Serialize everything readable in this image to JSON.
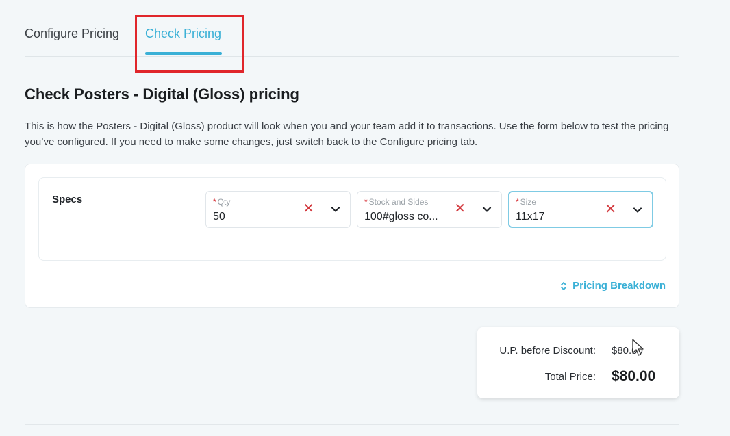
{
  "tabs": [
    {
      "label": "Configure Pricing",
      "active": false
    },
    {
      "label": "Check Pricing",
      "active": true
    }
  ],
  "heading": "Check Posters - Digital (Gloss) pricing",
  "description": "This is how the Posters - Digital (Gloss) product will look when you and your team add it to transactions. Use the form below to test the pricing you’ve configured. If you need to make some changes, just switch back to the Configure pricing tab.",
  "specs": {
    "label": "Specs",
    "fields": [
      {
        "label": "Qty",
        "value": "50",
        "required": true
      },
      {
        "label": "Stock and Sides",
        "value": "100#gloss co...",
        "required": true
      },
      {
        "label": "Size",
        "value": "11x17",
        "required": true
      }
    ]
  },
  "pricing_breakdown_label": "Pricing Breakdown",
  "summary": {
    "up_label": "U.P. before Discount:",
    "up_value": "$80.00",
    "total_label": "Total Price:",
    "total_value": "$80.00"
  },
  "colors": {
    "accent": "#3ab0d6",
    "highlight": "#e0262b",
    "clear": "#d33a3f"
  },
  "icons": {
    "clear": "x-icon",
    "dropdown": "chevron-down-icon",
    "breakdown": "sort-icon",
    "pointer": "cursor-icon"
  }
}
